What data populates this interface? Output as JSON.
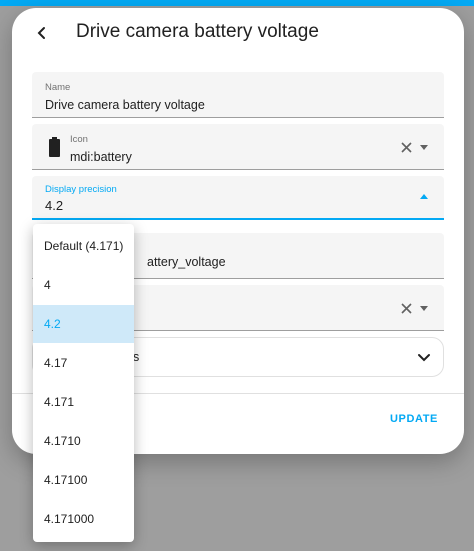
{
  "dialog": {
    "title": "Drive camera battery voltage",
    "name_field": {
      "label": "Name",
      "value": "Drive camera battery voltage"
    },
    "icon_field": {
      "label": "Icon",
      "value": "mdi:battery",
      "icon": "battery-icon"
    },
    "display_precision_field": {
      "label": "Display precision",
      "value": "4.2"
    },
    "entity_id_partial": "attery_voltage",
    "expander_partial": "s",
    "update_label": "UPDATE"
  },
  "precision_menu": {
    "options": [
      "Default (4.171)",
      "4",
      "4.2",
      "4.17",
      "4.171",
      "4.1710",
      "4.17100",
      "4.171000"
    ],
    "selected": "4.2"
  },
  "colors": {
    "accent": "#03a9f4",
    "selected_bg": "#cfe9f9",
    "field_bg": "#f5f5f5"
  }
}
